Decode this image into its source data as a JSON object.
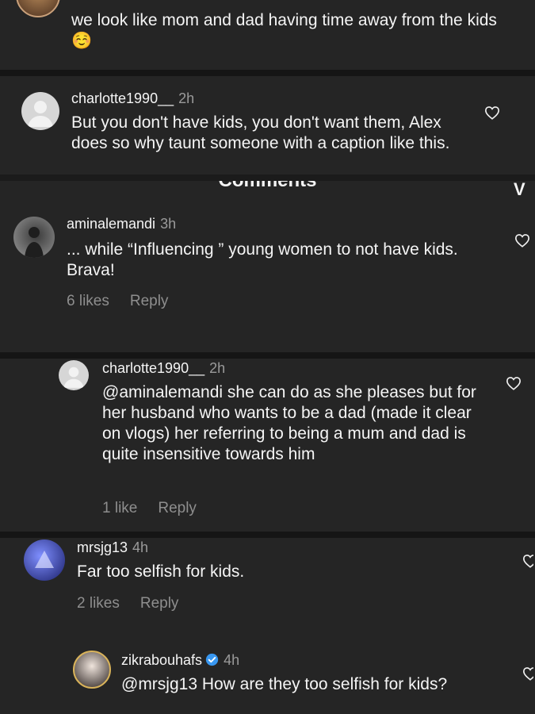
{
  "comment0": {
    "text": "we look like mom and dad having time away from the kids ☺️"
  },
  "comment1": {
    "username": "charlotte1990__",
    "time": "2h",
    "text": "But you don't have kids, you don't want them, Alex does so why taunt someone with a caption like this."
  },
  "header": {
    "title": "Comments",
    "chevron": "V"
  },
  "comment2": {
    "username": "aminalemandi",
    "time": "3h",
    "text": "... while “Influencing ” young women to not have kids. Brava!",
    "likes": "6 likes",
    "reply": "Reply"
  },
  "comment3": {
    "username": "charlotte1990__",
    "time": "2h",
    "text": "@aminalemandi she can do as she pleases but for her husband who wants to be a dad (made it clear on vlogs) her referring to being a mum and dad is quite insensitive towards him",
    "likes": "1 like",
    "reply": "Reply"
  },
  "comment4": {
    "username": "mrsjg13",
    "time": "4h",
    "text": "Far too selfish for kids.",
    "likes": "2 likes",
    "reply": "Reply"
  },
  "comment5": {
    "username": "zikrabouhafs",
    "time": "4h",
    "text": "@mrsjg13 How are they too selfish for kids?"
  },
  "colors": {
    "background": "#1b1b1b",
    "panel": "#252525",
    "muted": "#8e8e8e",
    "verified": "#3897f0"
  },
  "icons": [
    "heart-icon",
    "verified-badge-icon",
    "chevron-down-icon"
  ]
}
